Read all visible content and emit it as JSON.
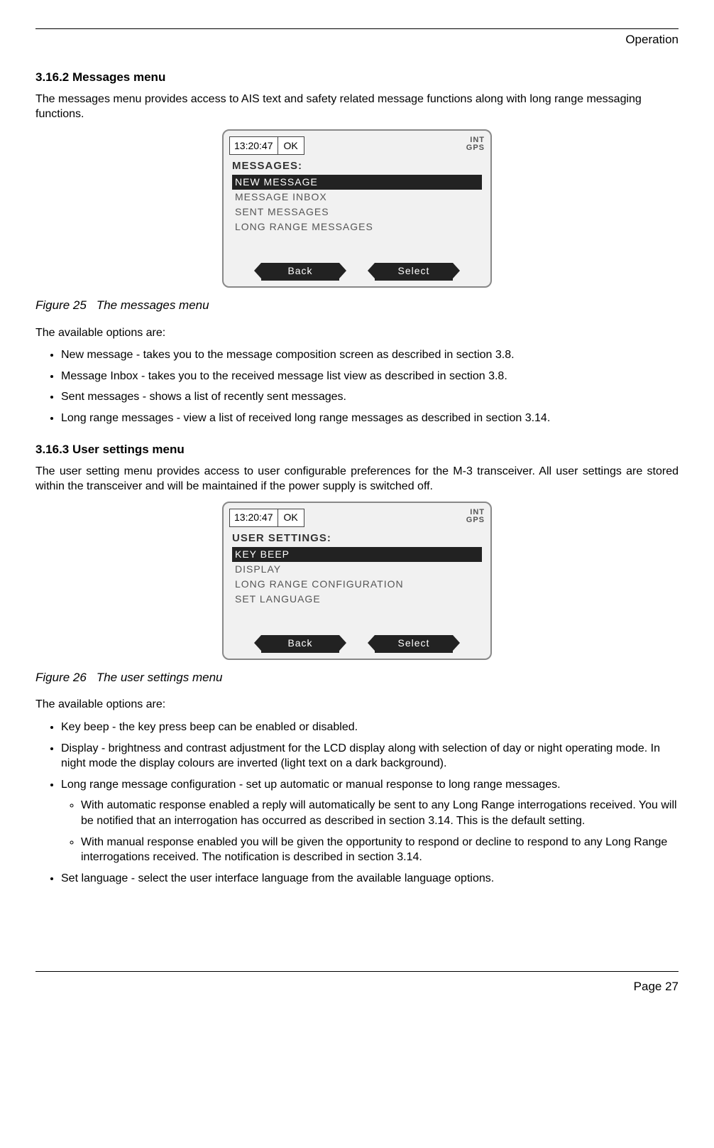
{
  "header": {
    "section_label": "Operation"
  },
  "s1": {
    "heading": "3.16.2  Messages menu",
    "intro": "The messages menu provides access to AIS text and safety related message functions along with long range messaging functions."
  },
  "device1": {
    "time": "13:20:47",
    "ok": "OK",
    "int": "INT",
    "gps": "GPS",
    "title": "MESSAGES:",
    "items": {
      "i0": "NEW MESSAGE",
      "i1": "MESSAGE INBOX",
      "i2": "SENT MESSAGES",
      "i3": "LONG RANGE MESSAGES"
    },
    "back": "Back",
    "select": "Select"
  },
  "fig1": {
    "num": "Figure 25",
    "caption": "The messages menu"
  },
  "opts1": {
    "lead": "The available options are:",
    "b0": "New message - takes you to the message composition screen as described in section 3.8.",
    "b1": "Message Inbox - takes you to the received message list view as described in section 3.8.",
    "b2": "Sent messages - shows a list of recently sent messages.",
    "b3": "Long range messages - view a list of received long range messages as described in section 3.14."
  },
  "s2": {
    "heading": "3.16.3  User settings menu",
    "intro": "The user setting menu provides access to user configurable preferences for the M-3 transceiver. All user settings are stored within the transceiver and will be maintained if the power supply is switched off."
  },
  "device2": {
    "time": "13:20:47",
    "ok": "OK",
    "int": "INT",
    "gps": "GPS",
    "title": "USER SETTINGS:",
    "items": {
      "i0": "KEY BEEP",
      "i1": "DISPLAY",
      "i2": "LONG RANGE CONFIGURATION",
      "i3": "SET LANGUAGE"
    },
    "back": "Back",
    "select": "Select"
  },
  "fig2": {
    "num": "Figure 26",
    "caption": "The user settings menu"
  },
  "opts2": {
    "lead": "The available options are:",
    "b0": "Key beep - the key press beep can be enabled or disabled.",
    "b1": "Display - brightness and contrast adjustment for the LCD display along with selection of day or night operating mode. In night mode the display colours are inverted (light text on a dark background).",
    "b2": "Long range message configuration - set up automatic or manual response to long range messages.",
    "b2a": "With automatic response enabled a reply will automatically be sent to any Long Range interrogations received. You will be notified that an interrogation has occurred as described in section 3.14. This is the default setting.",
    "b2b": "With manual response enabled you will be given the opportunity to respond or decline to respond to any Long Range interrogations received. The notification is described in section 3.14.",
    "b3": "Set language - select the user interface language from the available language options."
  },
  "footer": {
    "page": "Page 27"
  }
}
